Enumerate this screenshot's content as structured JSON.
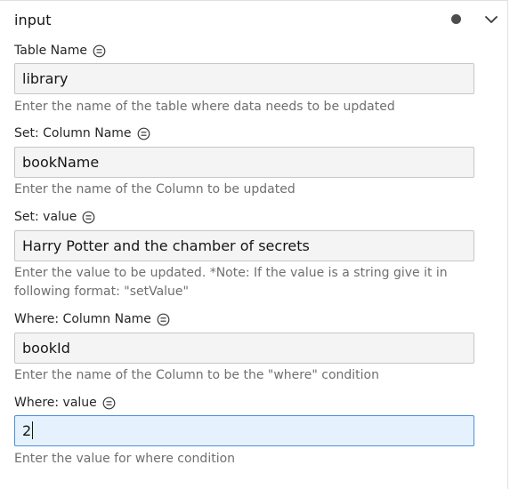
{
  "panel": {
    "title": "input"
  },
  "fields": [
    {
      "label": "Table Name",
      "value": "library",
      "helper": "Enter the name of the table where data needs to be updated"
    },
    {
      "label": "Set: Column Name",
      "value": "bookName",
      "helper": "Enter the name of the Column to be updated"
    },
    {
      "label": "Set: value",
      "value": "Harry Potter and the chamber of secrets",
      "helper_line1": "Enter the value to be updated. *Note: If the value is a string give it in",
      "helper_line2": "following format: \"setValue\""
    },
    {
      "label": "Where: Column Name",
      "value": "bookId",
      "helper": "Enter the name of the Column to be the \"where\" condition"
    },
    {
      "label": "Where: value",
      "value": "2",
      "helper": "Enter the value for where condition"
    }
  ],
  "icons": {
    "status": "status-dot-icon",
    "collapse": "chevron-down-icon",
    "info": "info-icon"
  },
  "colors": {
    "input_bg": "#f4f4f4",
    "input_focus_bg": "#e5f2fd",
    "input_focus_border": "#4a90d9",
    "helper_text": "#6f6f6f"
  }
}
